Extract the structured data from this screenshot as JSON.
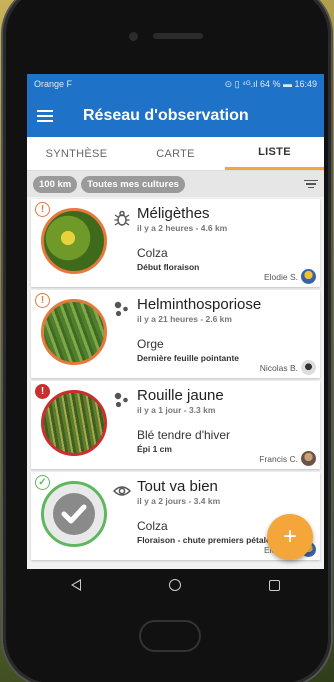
{
  "status": {
    "carrier": "Orange F",
    "indicators": "⊙ ▯ ⁴ᴳ.ıl 64 % ▬ 16:49"
  },
  "appbar": {
    "title": "Réseau d'observation",
    "menu_icon": "hamburger-menu-icon"
  },
  "tabs": [
    {
      "label": "SYNTHÈSE",
      "active": false
    },
    {
      "label": "CARTE",
      "active": false
    },
    {
      "label": "LISTE",
      "active": true
    }
  ],
  "filters": {
    "distance_chip": "100 km",
    "crop_chip": "Toutes mes cultures",
    "filter_icon": "filter-list-icon"
  },
  "observations": [
    {
      "title": "Méligèthes",
      "type_icon": "bug-icon",
      "time_distance": "il y a 2 heures - 4.6 km",
      "crop": "Colza",
      "stage": "Début floraison",
      "observer": "Elodie S.",
      "status": "alert",
      "ring_color": "#e5783a"
    },
    {
      "title": "Helminthosporiose",
      "type_icon": "disease-dots-icon",
      "time_distance": "il y a 21 heures - 2.6 km",
      "crop": "Orge",
      "stage": "Dernière feuille pointante",
      "observer": "Nicolas B.",
      "status": "alert",
      "ring_color": "#e5783a"
    },
    {
      "title": "Rouille jaune",
      "type_icon": "disease-dots-icon",
      "time_distance": "il y a 1 jour - 3.3 km",
      "crop": "Blé tendre d'hiver",
      "stage": "Épi 1 cm",
      "observer": "Francis C.",
      "status": "danger",
      "ring_color": "#c8302f"
    },
    {
      "title": "Tout va bien",
      "type_icon": "eye-icon",
      "time_distance": "il y a 2 jours - 3.4 km",
      "crop": "Colza",
      "stage": "Floraison - chute premiers pétales",
      "observer": "Elodie S.",
      "status": "ok",
      "ring_color": "#5fb85f"
    }
  ],
  "fab": {
    "label": "+"
  },
  "colors": {
    "primary": "#1e73c8",
    "accent": "#f4a63a",
    "alert": "#e5783a",
    "danger": "#c8302f",
    "ok": "#5fb85f"
  }
}
